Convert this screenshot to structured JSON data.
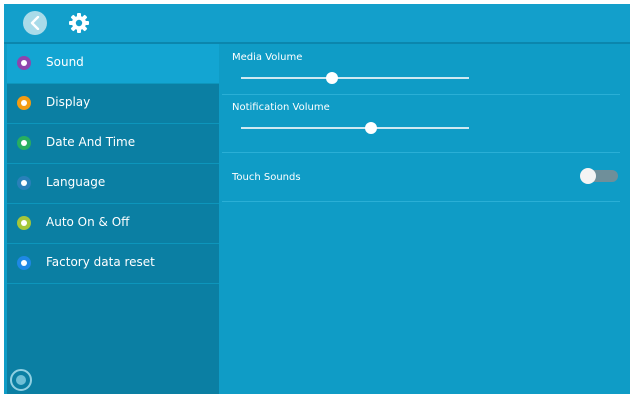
{
  "nav": {
    "items": [
      {
        "label": "Sound",
        "icon": "sound-icon",
        "color": "#8e44ad",
        "active": true
      },
      {
        "label": "Display",
        "icon": "display-icon",
        "color": "#f39c12",
        "active": false
      },
      {
        "label": "Date And Time",
        "icon": "clock-icon",
        "color": "#27ae60",
        "active": false
      },
      {
        "label": "Language",
        "icon": "globe-icon",
        "color": "#2980b9",
        "active": false
      },
      {
        "label": "Auto On & Off",
        "icon": "power-schedule-icon",
        "color": "#a4c639",
        "active": false
      },
      {
        "label": "Factory data reset",
        "icon": "reset-icon",
        "color": "#1e88e5",
        "active": false
      }
    ]
  },
  "sound": {
    "media_volume_label": "Media Volume",
    "media_volume_level": 0.4,
    "notification_volume_label": "Notification Volume",
    "notification_volume_level": 0.57,
    "touch_sounds_label": "Touch Sounds",
    "touch_sounds_on": false
  },
  "colors": {
    "topbar": "#139fcb",
    "sidebar": "#0b7fa3",
    "sidebar_active": "#13a5d2",
    "content": "#0f9cc6"
  }
}
